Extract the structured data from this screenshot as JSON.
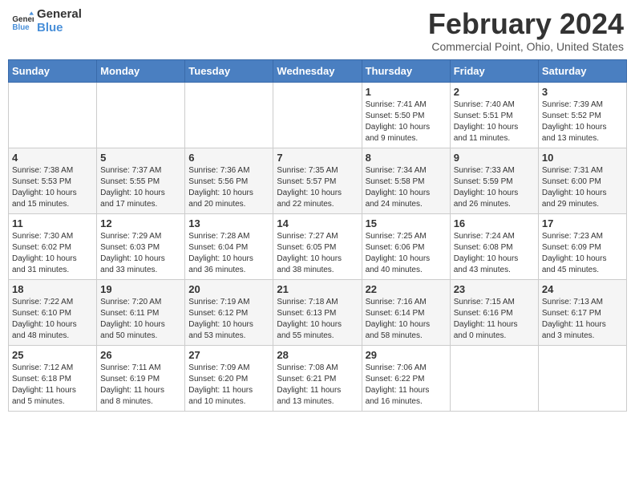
{
  "header": {
    "logo_general": "General",
    "logo_blue": "Blue",
    "month_year": "February 2024",
    "location": "Commercial Point, Ohio, United States"
  },
  "weekdays": [
    "Sunday",
    "Monday",
    "Tuesday",
    "Wednesday",
    "Thursday",
    "Friday",
    "Saturday"
  ],
  "weeks": [
    [
      {
        "day": "",
        "info": ""
      },
      {
        "day": "",
        "info": ""
      },
      {
        "day": "",
        "info": ""
      },
      {
        "day": "",
        "info": ""
      },
      {
        "day": "1",
        "info": "Sunrise: 7:41 AM\nSunset: 5:50 PM\nDaylight: 10 hours\nand 9 minutes."
      },
      {
        "day": "2",
        "info": "Sunrise: 7:40 AM\nSunset: 5:51 PM\nDaylight: 10 hours\nand 11 minutes."
      },
      {
        "day": "3",
        "info": "Sunrise: 7:39 AM\nSunset: 5:52 PM\nDaylight: 10 hours\nand 13 minutes."
      }
    ],
    [
      {
        "day": "4",
        "info": "Sunrise: 7:38 AM\nSunset: 5:53 PM\nDaylight: 10 hours\nand 15 minutes."
      },
      {
        "day": "5",
        "info": "Sunrise: 7:37 AM\nSunset: 5:55 PM\nDaylight: 10 hours\nand 17 minutes."
      },
      {
        "day": "6",
        "info": "Sunrise: 7:36 AM\nSunset: 5:56 PM\nDaylight: 10 hours\nand 20 minutes."
      },
      {
        "day": "7",
        "info": "Sunrise: 7:35 AM\nSunset: 5:57 PM\nDaylight: 10 hours\nand 22 minutes."
      },
      {
        "day": "8",
        "info": "Sunrise: 7:34 AM\nSunset: 5:58 PM\nDaylight: 10 hours\nand 24 minutes."
      },
      {
        "day": "9",
        "info": "Sunrise: 7:33 AM\nSunset: 5:59 PM\nDaylight: 10 hours\nand 26 minutes."
      },
      {
        "day": "10",
        "info": "Sunrise: 7:31 AM\nSunset: 6:00 PM\nDaylight: 10 hours\nand 29 minutes."
      }
    ],
    [
      {
        "day": "11",
        "info": "Sunrise: 7:30 AM\nSunset: 6:02 PM\nDaylight: 10 hours\nand 31 minutes."
      },
      {
        "day": "12",
        "info": "Sunrise: 7:29 AM\nSunset: 6:03 PM\nDaylight: 10 hours\nand 33 minutes."
      },
      {
        "day": "13",
        "info": "Sunrise: 7:28 AM\nSunset: 6:04 PM\nDaylight: 10 hours\nand 36 minutes."
      },
      {
        "day": "14",
        "info": "Sunrise: 7:27 AM\nSunset: 6:05 PM\nDaylight: 10 hours\nand 38 minutes."
      },
      {
        "day": "15",
        "info": "Sunrise: 7:25 AM\nSunset: 6:06 PM\nDaylight: 10 hours\nand 40 minutes."
      },
      {
        "day": "16",
        "info": "Sunrise: 7:24 AM\nSunset: 6:08 PM\nDaylight: 10 hours\nand 43 minutes."
      },
      {
        "day": "17",
        "info": "Sunrise: 7:23 AM\nSunset: 6:09 PM\nDaylight: 10 hours\nand 45 minutes."
      }
    ],
    [
      {
        "day": "18",
        "info": "Sunrise: 7:22 AM\nSunset: 6:10 PM\nDaylight: 10 hours\nand 48 minutes."
      },
      {
        "day": "19",
        "info": "Sunrise: 7:20 AM\nSunset: 6:11 PM\nDaylight: 10 hours\nand 50 minutes."
      },
      {
        "day": "20",
        "info": "Sunrise: 7:19 AM\nSunset: 6:12 PM\nDaylight: 10 hours\nand 53 minutes."
      },
      {
        "day": "21",
        "info": "Sunrise: 7:18 AM\nSunset: 6:13 PM\nDaylight: 10 hours\nand 55 minutes."
      },
      {
        "day": "22",
        "info": "Sunrise: 7:16 AM\nSunset: 6:14 PM\nDaylight: 10 hours\nand 58 minutes."
      },
      {
        "day": "23",
        "info": "Sunrise: 7:15 AM\nSunset: 6:16 PM\nDaylight: 11 hours\nand 0 minutes."
      },
      {
        "day": "24",
        "info": "Sunrise: 7:13 AM\nSunset: 6:17 PM\nDaylight: 11 hours\nand 3 minutes."
      }
    ],
    [
      {
        "day": "25",
        "info": "Sunrise: 7:12 AM\nSunset: 6:18 PM\nDaylight: 11 hours\nand 5 minutes."
      },
      {
        "day": "26",
        "info": "Sunrise: 7:11 AM\nSunset: 6:19 PM\nDaylight: 11 hours\nand 8 minutes."
      },
      {
        "day": "27",
        "info": "Sunrise: 7:09 AM\nSunset: 6:20 PM\nDaylight: 11 hours\nand 10 minutes."
      },
      {
        "day": "28",
        "info": "Sunrise: 7:08 AM\nSunset: 6:21 PM\nDaylight: 11 hours\nand 13 minutes."
      },
      {
        "day": "29",
        "info": "Sunrise: 7:06 AM\nSunset: 6:22 PM\nDaylight: 11 hours\nand 16 minutes."
      },
      {
        "day": "",
        "info": ""
      },
      {
        "day": "",
        "info": ""
      }
    ]
  ]
}
